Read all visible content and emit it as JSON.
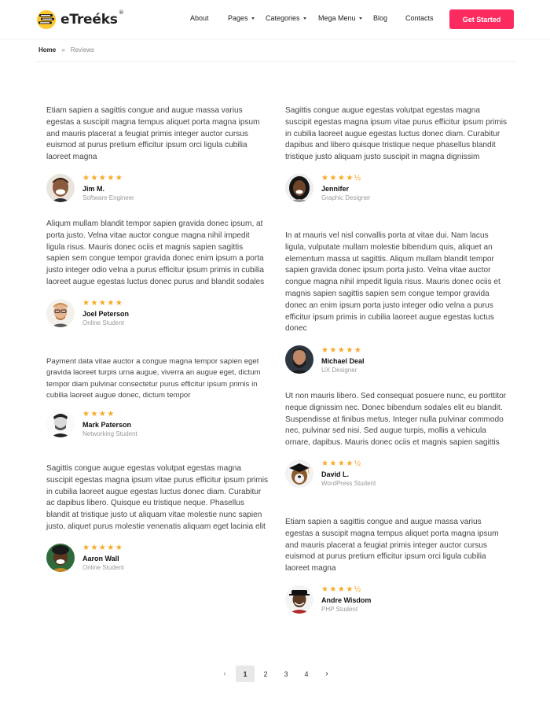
{
  "header": {
    "logo_text": "eTreéks",
    "logo_reg": "®",
    "nav": [
      {
        "label": "About",
        "caret": false
      },
      {
        "label": "Pages",
        "caret": true
      },
      {
        "label": "Categories",
        "caret": true
      },
      {
        "label": "Mega Menu",
        "caret": true
      },
      {
        "label": "Blog",
        "caret": false
      },
      {
        "label": "Contacts",
        "caret": false
      }
    ],
    "cta_label": "Get Started",
    "accent_color": "#fb2a5f"
  },
  "breadcrumb": {
    "home": "Home",
    "separator": "»",
    "current": "Reviews"
  },
  "reviews_left": [
    {
      "text": "Etiam sapien a sagittis congue and augue massa varius egestas a suscipit magna tempus aliquet porta magna ipsum and mauris placerat a feugiat primis integer auctor cursus euismod at purus pretium efficitur ipsum orci ligula cubilia laoreet magna",
      "stars": "★★★★★",
      "rating": 5,
      "name": "Jim M.",
      "role": "Software Engineer"
    },
    {
      "text": "Aliqum mullam blandit tempor sapien gravida donec ipsum, at porta justo. Velna vitae auctor congue magna nihil impedit ligula risus. Mauris donec ociis et magnis sapien sagittis sapien sem congue tempor gravida donec enim ipsum a porta justo integer odio velna a purus efficitur ipsum primis in cubilia laoreet augue egestas luctus donec purus and blandit sodales",
      "stars": "★★★★★",
      "rating": 5,
      "name": "Joel Peterson",
      "role": "Online Student"
    },
    {
      "text": "Payment data vitae auctor a congue magna tempor sapien eget gravida laoreet turpis urna augue, viverra an augue eget, dictum tempor diam pulvinar consectetur purus efficitur ipsum primis in cubilia laoreet augue donec, dictum tempor",
      "stars": "★★★★",
      "rating": 4,
      "name": "Mark Paterson",
      "role": "Networking Student"
    },
    {
      "text": "Sagittis congue augue egestas volutpat egestas magna suscipit egestas magna ipsum vitae purus efficitur ipsum primis in cubilia laoreet augue egestas luctus donec diam. Curabitur ac dapibus libero. Quisque eu tristique neque. Phasellus blandit at tristique justo ut aliquam vitae molestie nunc sapien justo, aliquet purus molestie venenatis aliquam eget lacinia elit",
      "stars": "★★★★★",
      "rating": 5,
      "name": "Aaron Wall",
      "role": "Online Student"
    }
  ],
  "reviews_right": [
    {
      "text": "Sagittis congue augue egestas volutpat egestas magna suscipit egestas magna ipsum vitae purus efficitur ipsum primis in cubilia laoreet augue egestas luctus donec diam. Curabitur dapibus and libero quisque tristique neque phasellus blandit tristique justo aliquam justo suscipit in magna dignissim",
      "stars": "★★★★½",
      "rating": 4.5,
      "name": "Jennifer",
      "role": "Graphic Designer"
    },
    {
      "text": "In at mauris vel nisl convallis porta at vitae dui. Nam lacus ligula, vulputate mullam molestie bibendum quis, aliquet an elementum massa ut sagittis. Aliqum mullam blandit tempor sapien gravida donec ipsum porta justo. Velna vitae auctor congue magna nihil impedit ligula risus. Mauris donec ociis et magnis sapien sagittis sapien sem congue tempor gravida donec an enim ipsum porta justo integer odio velna a purus efficitur ipsum primis in cubilia laoreet augue egestas luctus donec",
      "stars": "★★★★★",
      "rating": 5,
      "name": "Michael Deal",
      "role": "UX Designer"
    },
    {
      "text": "Ut non mauris libero. Sed consequat posuere nunc, eu porttitor neque dignissim nec. Donec bibendum sodales elit eu blandit. Suspendisse at finibus metus. Integer nulla pulvinar commodo nec, pulvinar sed nisi. Sed augue turpis, mollis a vehicula ornare, dapibus. Mauris donec ociis et magnis sapien sagittis",
      "stars": "★★★★½",
      "rating": 4.5,
      "name": "David L.",
      "role": "WordPress Student"
    },
    {
      "text": "Etiam sapien a sagittis congue and augue massa varius egestas a suscipit magna tempus aliquet porta magna ipsum and mauris placerat a feugiat primis integer auctor cursus euismod at purus pretium efficitur ipsum orci ligula cubilia laoreet magna",
      "stars": "★★★★½",
      "rating": 4.5,
      "name": "Andre Wisdom",
      "role": "PHP Student"
    }
  ],
  "pagination": {
    "prev": "‹",
    "pages": [
      "1",
      "2",
      "3",
      "4"
    ],
    "active": "1",
    "next": "›"
  }
}
